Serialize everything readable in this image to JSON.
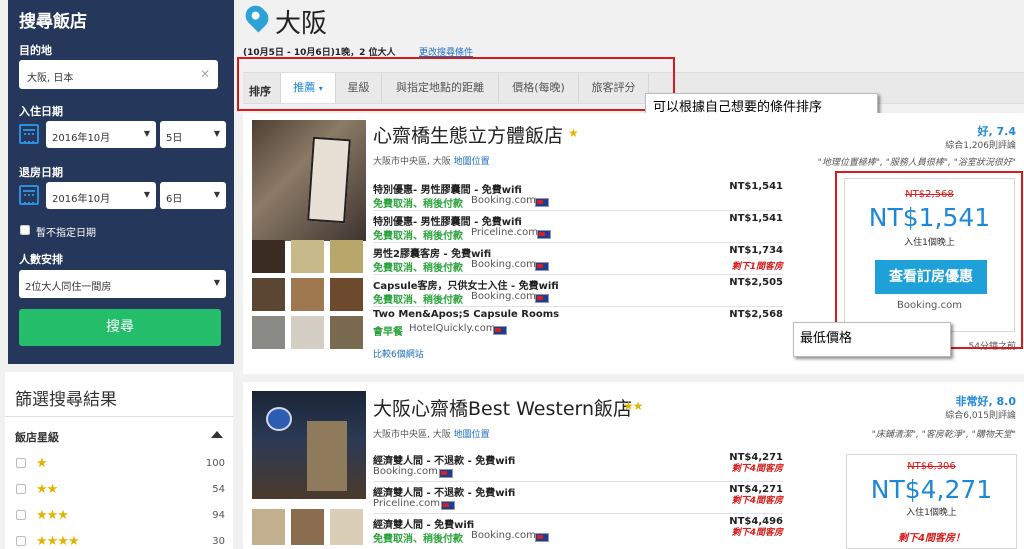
{
  "sidebar": {
    "title": "搜尋飯店",
    "destination_label": "目的地",
    "destination_value": "大阪, 日本",
    "checkin_label": "入住日期",
    "checkin_month": "2016年10月",
    "checkin_day": "5日",
    "checkout_label": "退房日期",
    "checkout_month": "2016年10月",
    "checkout_day": "6日",
    "no_date_label": "暫不指定日期",
    "guests_label": "人數安排",
    "guests_value": "2位大人同住一間房",
    "search_button": "搜尋"
  },
  "filter": {
    "title": "篩選搜尋結果",
    "star_section": "飯店星級",
    "rows": [
      {
        "stars": "★",
        "count": "100"
      },
      {
        "stars": "★★",
        "count": "54"
      },
      {
        "stars": "★★★",
        "count": "94"
      },
      {
        "stars": "★★★★",
        "count": "30"
      }
    ]
  },
  "header": {
    "city": "大阪",
    "dates": "(10月5日 - 10月6日)1晚，2 位大人",
    "change_link": "更改搜尋條件"
  },
  "sort": {
    "label": "排序",
    "tabs": [
      "推薦",
      "星級",
      "與指定地點的距離",
      "價格(每晚)",
      "旅客評分"
    ],
    "active_marker": "▾"
  },
  "annotations": {
    "sort_note": "可以根據自己想要的條件排序",
    "price_note": "最低價格"
  },
  "hotels": [
    {
      "name": "心齋橋生態立方體飯店",
      "stars": "★",
      "address": "大阪市中央區, 大阪",
      "map_link": "地圖位置",
      "rating": "好, 7.4",
      "reviews": "綜合1,206則評論",
      "quote": "\"地理位置極棒\", \"服務人員很棒\", \"浴室狀況很好\"",
      "offers": [
        {
          "title": "特別優惠- 男性膠囊間 - 免費wifi",
          "green": "免費取消、稍後付款",
          "source": "Booking.com",
          "price": "NT$1,541",
          "remark": ""
        },
        {
          "title": "特別優惠- 男性膠囊間 - 免費wifi",
          "green": "免費取消、稍後付款",
          "source": "Priceline.com",
          "price": "NT$1,541",
          "remark": ""
        },
        {
          "title": "男性2膠囊客房 - 免費wifi",
          "green": "免費取消、稍後付款",
          "source": "Booking.com",
          "price": "NT$1,734",
          "remark": "剩下1間客房"
        },
        {
          "title": "Capsule客房，只供女士入住 - 免費wifi",
          "green": "免費取消、稍後付款",
          "source": "Booking.com",
          "price": "NT$2,505",
          "remark": ""
        },
        {
          "title": "Two Men&Apos;S Capsule Rooms",
          "green": "會早餐",
          "source": "HotelQuickly.com",
          "price": "NT$2,568",
          "remark": ""
        }
      ],
      "compare": "比較6個網站",
      "updated": "54分鐘之前",
      "best": {
        "old": "NT$2,568",
        "price": "NT$1,541",
        "per": "入住1個晚上",
        "button": "查看訂房優惠",
        "provider": "Booking.com"
      }
    },
    {
      "name": "大阪心齋橋Best Western飯店",
      "stars": "★★",
      "address": "大阪市中央區, 大阪",
      "map_link": "地圖位置",
      "rating": "非常好, 8.0",
      "reviews": "綜合6,015則評論",
      "quote": "\"床鋪清潔\", \"客房乾淨\", \"購物天堂\"",
      "offers": [
        {
          "title": "經濟雙人間 - 不退款 - 免費wifi",
          "green": "",
          "source": "Booking.com",
          "price": "NT$4,271",
          "remark": "剩下4間客房"
        },
        {
          "title": "經濟雙人間 - 不退款 - 免費wifi",
          "green": "",
          "source": "Priceline.com",
          "price": "NT$4,271",
          "remark": "剩下4間客房"
        },
        {
          "title": "經濟雙人間 - 免費wifi",
          "green": "免費取消、稍後付款",
          "source": "Booking.com",
          "price": "NT$4,496",
          "remark": "剩下4間客房"
        }
      ],
      "best": {
        "old": "NT$6,306",
        "price": "NT$4,271",
        "per": "入住1個晚上",
        "remain": "剩下4間客房！"
      }
    }
  ],
  "colors": {
    "sidebar_bg": "#25375a",
    "accent_blue": "#1f88d6",
    "search_green": "#24be6a",
    "highlight_red": "#d51b1b"
  }
}
